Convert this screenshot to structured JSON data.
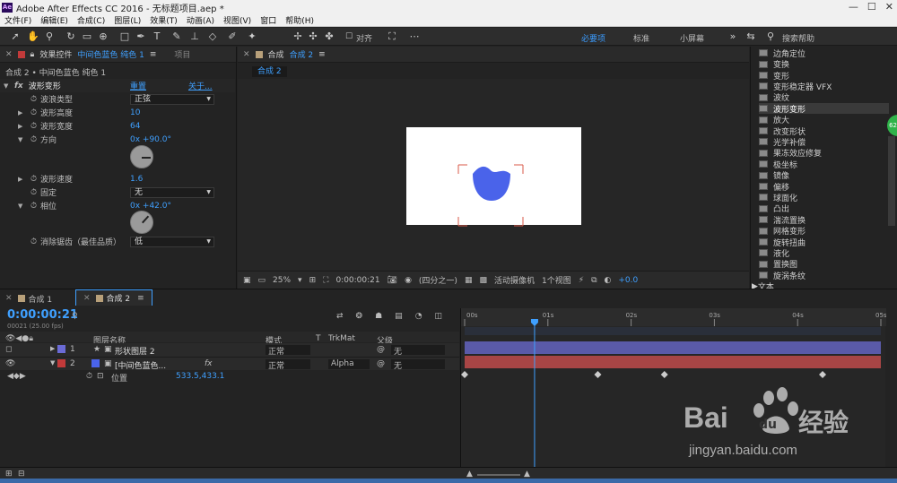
{
  "app": {
    "title": "Adobe After Effects CC 2016 - 无标题项目.aep *",
    "logo": "Ae"
  },
  "menu": [
    "文件(F)",
    "编辑(E)",
    "合成(C)",
    "图层(L)",
    "效果(T)",
    "动画(A)",
    "视图(V)",
    "窗口",
    "帮助(H)"
  ],
  "toolbar": {
    "align_label": "对齐",
    "workspaces": [
      "必要项",
      "标准",
      "小屏幕"
    ],
    "search_label": "搜索帮助"
  },
  "effect_controls": {
    "tab_label": "效果控件",
    "tab_layer": "中间色蓝色 纯色 1",
    "tab_project": "项目",
    "breadcrumb": "合成 2 • 中间色蓝色 纯色 1",
    "effect_name": "波形变形",
    "reset": "重置",
    "about": "关于...",
    "props": [
      {
        "label": "波浪类型",
        "value": "正弦",
        "kind": "select"
      },
      {
        "label": "波形高度",
        "value": "10",
        "kind": "num"
      },
      {
        "label": "波形宽度",
        "value": "64",
        "kind": "num"
      },
      {
        "label": "方向",
        "value": "0x +90.0°",
        "kind": "angle"
      },
      {
        "label": "波形速度",
        "value": "1.6",
        "kind": "num"
      },
      {
        "label": "固定",
        "value": "无",
        "kind": "select"
      },
      {
        "label": "相位",
        "value": "0x +42.0°",
        "kind": "angle"
      },
      {
        "label": "消除锯齿（最佳品质）",
        "value": "低",
        "kind": "select"
      }
    ]
  },
  "comp_viewer": {
    "tab_label": "合成",
    "tab_name": "合成 2",
    "subtab": "合成 2",
    "zoom": "25%",
    "timecode": "0:00:00:21",
    "resolution": "(四分之一)",
    "camera": "活动摄像机",
    "views": "1个视图",
    "exposure": "+0.0"
  },
  "effects_list": {
    "items": [
      "边角定位",
      "变换",
      "变形",
      "变形稳定器 VFX",
      "波纹",
      "波形变形",
      "放大",
      "改变形状",
      "光学补偿",
      "果冻效应修复",
      "极坐标",
      "镜像",
      "偏移",
      "球面化",
      "凸出",
      "湍流置换",
      "网格变形",
      "旋转扭曲",
      "液化",
      "置换图",
      "旋涡条纹"
    ],
    "selected": "波形变形",
    "folder": "文本",
    "badge": "62"
  },
  "timeline": {
    "tabs": [
      "合成 1",
      "合成 2"
    ],
    "active_tab": "合成 2",
    "timecode": "0:00:00:21",
    "fps": "00021 (25.00 fps)",
    "columns": {
      "name": "图层名称",
      "mode": "模式",
      "t": "T",
      "trkmat": "TrkMat",
      "parent": "父级"
    },
    "layers": [
      {
        "num": "1",
        "name": "形状图层 2",
        "mode": "正常",
        "trkmat": "",
        "parent": "无",
        "color": "#6b6bd6",
        "bar": "#5a5aa8"
      },
      {
        "num": "2",
        "name": "[中间色蓝色...",
        "mode": "正常",
        "trkmat": "Alpha",
        "parent": "无",
        "color": "#c23a3a",
        "bar": "#a84545"
      }
    ],
    "sub_prop": {
      "label": "位置",
      "value": "533.5,433.1"
    },
    "ruler": [
      "00s",
      "01s",
      "02s",
      "03s",
      "04s",
      "05s"
    ],
    "playhead_t": 0.84,
    "duration": 5,
    "keyframes": [
      0,
      1.6,
      2.4,
      4.3
    ]
  },
  "watermark": {
    "brand_a": "Bai",
    "brand_b": "du",
    "brand_cn": "经验",
    "url": "jingyan.baidu.com"
  }
}
